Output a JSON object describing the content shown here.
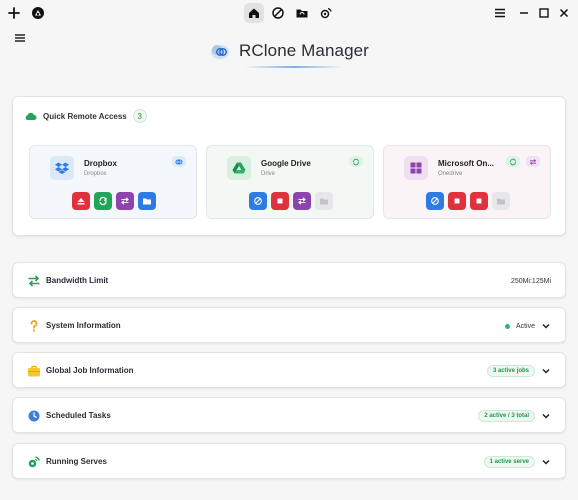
{
  "header": {
    "title": "RClone Manager"
  },
  "quick_access": {
    "title": "Quick Remote Access",
    "count": "3",
    "remotes": [
      {
        "name": "Dropbox",
        "type": "Dropbox"
      },
      {
        "name": "Google Drive",
        "type": "Drive"
      },
      {
        "name": "Microsoft On...",
        "type": "Onedrive"
      }
    ]
  },
  "sections": [
    {
      "label": "Bandwidth Limit",
      "value": "250Mi:125Mi"
    },
    {
      "label": "System Information",
      "value": "Active"
    },
    {
      "label": "Global Job Information",
      "value": "3 active jobs"
    },
    {
      "label": "Scheduled Tasks",
      "value": "2 active / 3 total"
    },
    {
      "label": "Running Serves",
      "value": "1 active serve"
    }
  ],
  "colors": {
    "accent_blue": "#2f7be5",
    "accent_green": "#22a55a",
    "accent_red": "#e0323c",
    "accent_purple": "#8e44ad",
    "status_green": "#2fb66e"
  },
  "icons": {
    "titlebar": [
      "plus-icon",
      "app-icon",
      "home-icon",
      "mount-icon",
      "folder-sync-icon",
      "serve-icon",
      "hamburger-icon",
      "minimize-icon",
      "maximize-icon",
      "close-icon"
    ],
    "section_icons": [
      "transfer-arrows-icon",
      "question-icon",
      "briefcase-icon",
      "clock-icon",
      "broadcast-icon"
    ]
  }
}
